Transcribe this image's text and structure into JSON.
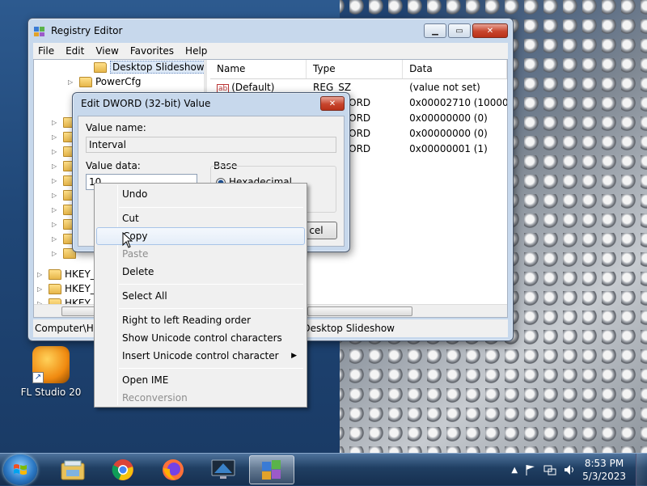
{
  "regedit": {
    "title": "Registry Editor",
    "menu": [
      "File",
      "Edit",
      "View",
      "Favorites",
      "Help"
    ],
    "tree": {
      "selected": "Desktop Slideshow",
      "items": [
        "PowerCfg"
      ],
      "hives": [
        "HKEY_",
        "HKEY_",
        "HKEY_("
      ]
    },
    "columns": [
      "Name",
      "Type",
      "Data"
    ],
    "rows": [
      {
        "name": "(Default)",
        "type": "REG_SZ",
        "data": "(value not set)"
      },
      {
        "name": "",
        "type": "ORD",
        "data": "0x00002710 (10000)"
      },
      {
        "name": "",
        "type": "ORD",
        "data": "0x00000000 (0)"
      },
      {
        "name": "",
        "type": "ORD",
        "data": "0x00000000 (0)"
      },
      {
        "name": "",
        "type": "ORD",
        "data": "0x00000001 (1)"
      }
    ],
    "status_left": "Computer\\HK",
    "status_right": "\\Desktop Slideshow"
  },
  "dialog": {
    "title": "Edit DWORD (32-bit) Value",
    "value_name_label": "Value name:",
    "value_name": "Interval",
    "value_data_label": "Value data:",
    "value_data": "10",
    "base_label": "Base",
    "base_option": "Hexadecimal",
    "cancel_partial": "cel"
  },
  "context_menu": {
    "items": [
      {
        "label": "Undo",
        "disabled": false
      },
      {
        "label": "Cut",
        "disabled": false
      },
      {
        "label": "Copy",
        "disabled": false
      },
      {
        "label": "Paste",
        "disabled": true
      },
      {
        "label": "Delete",
        "disabled": false
      },
      {
        "label": "Select All",
        "disabled": false
      },
      {
        "label": "Right to left Reading order",
        "disabled": false
      },
      {
        "label": "Show Unicode control characters",
        "disabled": false
      },
      {
        "label": "Insert Unicode control character",
        "disabled": false
      },
      {
        "label": "Open IME",
        "disabled": false
      },
      {
        "label": "Reconversion",
        "disabled": true
      }
    ]
  },
  "desktop": {
    "icons": [
      "FL Studio 20"
    ]
  },
  "taskbar": {
    "apps": [
      "file-explorer-icon",
      "chrome-icon",
      "firefox-icon",
      "remote-desktop-icon",
      "registry-editor-icon"
    ],
    "time": "8:53 PM",
    "date": "5/3/2023"
  },
  "colors": {
    "accent": "#2b78c4",
    "menu_hover": "#e4edf8"
  }
}
